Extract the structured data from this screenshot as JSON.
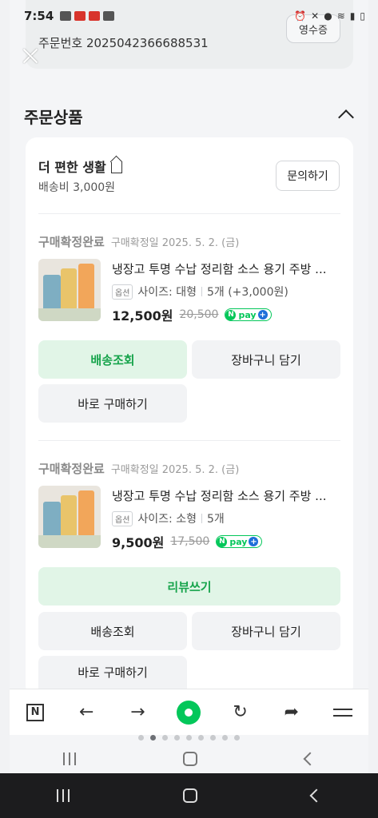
{
  "status_bar": {
    "time": "7:54"
  },
  "order": {
    "number_label": "주문번호 2025042366688531",
    "receipt_label": "영수증"
  },
  "section": {
    "title": "주문상품"
  },
  "store": {
    "name": "더 편한 생활",
    "shipping_fee": "배송비 3,000원",
    "inquiry_label": "문의하기"
  },
  "items": [
    {
      "status": "구매확정완료",
      "date": "구매확정일 2025. 5. 2. (금)",
      "name": "냉장고 투명 수납 정리함 소스 용기 주방 ...",
      "option_tag": "옵션",
      "option": "사이즈: 대형",
      "quantity": "5개 (+3,000원)",
      "price": "12,500원",
      "original_price": "20,500",
      "buttons": {
        "track": "배송조회",
        "cart": "장바구니 담기",
        "buy": "바로 구매하기"
      }
    },
    {
      "status": "구매확정완료",
      "date": "구매확정일 2025. 5. 2. (금)",
      "name": "냉장고 투명 수납 정리함 소스 용기 주방 ...",
      "option_tag": "옵션",
      "option": "사이즈: 소형",
      "quantity": "5개",
      "price": "9,500원",
      "original_price": "17,500",
      "buttons": {
        "review": "리뷰쓰기",
        "track": "배송조회",
        "cart": "장바구니 담기",
        "buy": "바로 구매하기"
      }
    }
  ],
  "npay": {
    "n": "N",
    "text": "pay",
    "plus": "+"
  },
  "browser": {
    "n_label": "N",
    "icons": [
      "naver-n-icon",
      "back-arrow-icon",
      "forward-arrow-icon",
      "green-dot-icon",
      "refresh-icon",
      "share-icon",
      "menu-icon"
    ]
  },
  "colors": {
    "accent_green": "#03c75a",
    "review_text": "#17a44c",
    "review_bg": "#e1f5e7"
  }
}
